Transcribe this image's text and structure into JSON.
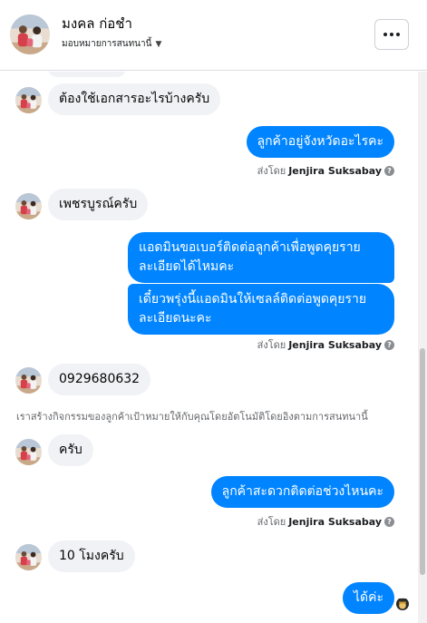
{
  "header": {
    "contact_name": "มงคล ก่อชำ",
    "assign_label": "มอบหมายการสนทนานี้",
    "menu_label": "เพิ่มเติม"
  },
  "messages": {
    "m1": "ต้องใช้เอกสารอะไรบ้างครับ",
    "m2": "ลูกค้าอยู่จังหวัดอะไรคะ",
    "m3": "เพชรบูรณ์ครับ",
    "m4": "แอดมินขอเบอร์ติดต่อลูกค้าเพื่อพูดคุยรายละเอียดได้ไหมคะ",
    "m5": "เดี๋ยวพรุ่งนี้แอดมินให้เซลล์ติดต่อพูดคุยรายละเอียดนะคะ",
    "m6": "0929680632",
    "m7": "ครับ",
    "m8": "ลูกค้าสะดวกติดต่อช่วงไหนคะ",
    "m9": "10  โมงครับ",
    "m10": "ได้ค่ะ"
  },
  "sent_by": {
    "prefix": "ส่งโดย",
    "agent": "Jenjira Suksabay",
    "info_icon": "?"
  },
  "system_notice": "เราสร้างกิจกรรมของลูกค้าเป้าหมายให้กับคุณโดยอัตโนมัติโดยอิงตามการสนทนานี้",
  "colors": {
    "outgoing_bubble": "#0084ff",
    "incoming_bubble": "#f0f2f5",
    "meta_text": "#65676b"
  },
  "icons": {
    "menu": "more-dots-icon",
    "caret": "chevron-down-icon",
    "info": "question-circle-icon"
  }
}
